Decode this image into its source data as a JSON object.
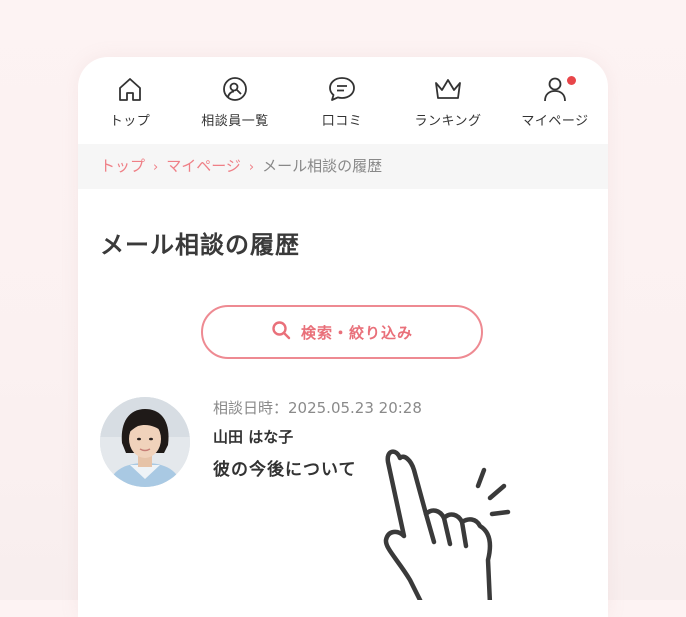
{
  "nav": {
    "items": [
      {
        "label": "トップ",
        "icon": "home-icon"
      },
      {
        "label": "相談員一覧",
        "icon": "counselor-search-icon"
      },
      {
        "label": "口コミ",
        "icon": "chat-bubble-icon"
      },
      {
        "label": "ランキング",
        "icon": "crown-icon"
      },
      {
        "label": "マイページ",
        "icon": "user-icon"
      }
    ]
  },
  "breadcrumb": {
    "items": [
      "トップ",
      "マイページ"
    ],
    "current": "メール相談の履歴",
    "separator": "›"
  },
  "page": {
    "title": "メール相談の履歴"
  },
  "search": {
    "label": "検索・絞り込み"
  },
  "history": [
    {
      "date": "相談日時：2025.05.23 20:28",
      "name": "山田 はな子",
      "subject": "彼の今後について"
    }
  ],
  "colors": {
    "accent": "#ee8a92",
    "notification": "#e8464a",
    "text": "#3a3a3a"
  }
}
